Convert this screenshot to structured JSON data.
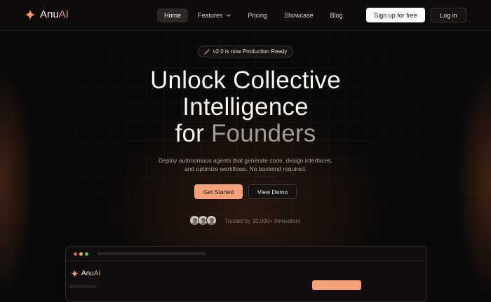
{
  "brand": {
    "name_prefix": "Anu",
    "name_suffix": "AI",
    "accent": "#f29a6b"
  },
  "nav": {
    "links": [
      {
        "label": "Home",
        "active": true
      },
      {
        "label": "Features",
        "has_dropdown": true
      },
      {
        "label": "Pricing"
      },
      {
        "label": "Showcase"
      },
      {
        "label": "Blog"
      }
    ],
    "signup_label": "Sign up for free",
    "login_label": "Log in"
  },
  "hero": {
    "badge": "v2.0 is now Production Ready",
    "headline_line1": "Unlock Collective",
    "headline_line2": "Intelligence",
    "headline_line3_a": "for ",
    "headline_line3_b": "Founders",
    "subtitle_line1": "Deploy autonomous agents that generate code, design interfaces,",
    "subtitle_line2": "and optimize workflows. No backend required.",
    "cta_primary": "Get Started",
    "cta_secondary": "View Demo",
    "trusted": "Trusted by 10,000+ innovators"
  },
  "preview": {
    "brand_prefix": "Anu",
    "brand_suffix": "AI"
  },
  "colors": {
    "accent": "#f4a07a",
    "background": "#0b0a0a"
  },
  "icons": [
    "sparkle-logo-icon",
    "chevron-down-icon",
    "magic-wand-icon",
    "avatar-icon"
  ]
}
